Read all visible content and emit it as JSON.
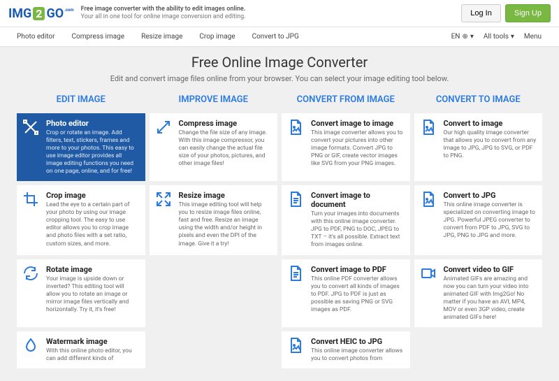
{
  "header": {
    "logo": {
      "p1": "IMG",
      "p2": "2",
      "p3": "GO",
      "p4": ".com"
    },
    "tagline1": "Free image converter with the ability to edit images online.",
    "tagline2": "Your all in one tool for online image conversion and editing.",
    "login": "Log In",
    "signup": "Sign Up"
  },
  "subnav": {
    "items": [
      "Photo editor",
      "Compress image",
      "Resize image",
      "Crop image",
      "Convert to JPG"
    ],
    "lang": "EN",
    "lang_icon": "⊕",
    "caret": "▾",
    "alltools": "All tools",
    "menu": "Menu"
  },
  "page": {
    "title": "Free Online Image Converter",
    "subtitle": "Edit and convert image files online from your browser. You can select your image editing tool below."
  },
  "columns": [
    "EDIT IMAGE",
    "IMPROVE IMAGE",
    "CONVERT FROM IMAGE",
    "CONVERT TO IMAGE"
  ],
  "cards": {
    "c0": [
      {
        "title": "Photo editor",
        "desc": "Crop or rotate an image. Add filters, text, stickers, frames and more to your photos. This easy to use image editor provides all image editing functions you need on one page, online, and for free!",
        "active": true
      },
      {
        "title": "Crop image",
        "desc": "Lead the eye to a certain part of your photo by using our image cropping tool. The easy to use editor allows you to crop image and photo files with a set ratio, custom sizes, and more."
      },
      {
        "title": "Rotate image",
        "desc": "Your image is upside down or inverted? This editing tool will allow you to rotate an image or mirror image files vertically and horizontally. Try it, it's free!"
      },
      {
        "title": "Watermark image",
        "desc": "With this online photo editor, you can add different kinds of"
      }
    ],
    "c1": [
      {
        "title": "Compress image",
        "desc": "Change the file size of any image. With this image compressor, you can easily change the actual file size of your photos, pictures, and other image files!"
      },
      {
        "title": "Resize image",
        "desc": "This image editing tool will help you to resize image files online, fast and free. Resize an image using the width and/or height in pixels and even the DPI of the image. Give it a try!"
      }
    ],
    "c2": [
      {
        "title": "Convert image to image",
        "desc": "This image converter allows you to convert your pictures into other image formats. Convert JPG to PNG or GIF, create vector images like SVG from your PNG images."
      },
      {
        "title": "Convert image to document",
        "desc": "Turn your images into documents with this online image converter. JPG to PDF, PNG to DOC, JPEG to TXT – it's all possible. Extract text from images online."
      },
      {
        "title": "Convert image to PDF",
        "desc": "This online PDF converter allows you to convert all kinds of images to PDF. JPG to PDF is just as possible as saving PNG or SVG images as PDF."
      },
      {
        "title": "Convert HEIC to JPG",
        "desc": "This online image converter allows you to convert photos from"
      }
    ],
    "c3": [
      {
        "title": "Convert to image",
        "desc": "Our high quality image converter that allows you to convert from any image to JPG, JPG to SVG, or PDF to PNG."
      },
      {
        "title": "Convert to JPG",
        "desc": "This online image converter is specialized on converting image to JPG. Powerful JPEG converter to convert from PDF to JPG, SVG to JPG, PNG to JPG and more."
      },
      {
        "title": "Convert video to GIF",
        "desc": "Animated GIFs are amazing and now you can turn your video into animated GIF with Img2Go! No matter if you have an AVI, MP4, MOV or even 3GP video, create animated GIFs here!"
      }
    ]
  }
}
